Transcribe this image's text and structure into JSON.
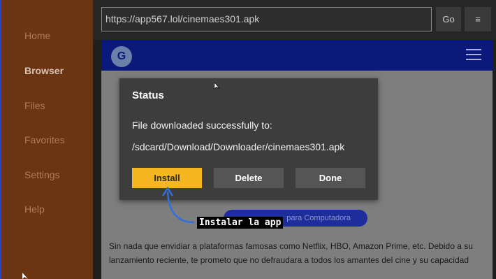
{
  "sidebar": {
    "items": [
      {
        "label": "Home",
        "active": false
      },
      {
        "label": "Browser",
        "active": true
      },
      {
        "label": "Files",
        "active": false
      },
      {
        "label": "Favorites",
        "active": false
      },
      {
        "label": "Settings",
        "active": false
      },
      {
        "label": "Help",
        "active": false
      }
    ]
  },
  "toolbar": {
    "url": "https://app567.lol/cinemaes301.apk",
    "go_label": "Go",
    "menu_icon": "menu-icon"
  },
  "webpage": {
    "pc_button_label": "para Computadora",
    "paragraph_line1": "Sin nada que envidiar a plataformas famosas como Netflix, HBO, Amazon Prime, etc. Debido a su",
    "paragraph_line2": "lanzamiento reciente, te prometo que no defraudara a todos los amantes del cine y su capacidad",
    "header_color": "#0b1a7a"
  },
  "dialog": {
    "title": "Status",
    "message": "File downloaded successfully to:",
    "path": "/sdcard/Download/Downloader/cinemaes301.apk",
    "install_label": "Install",
    "delete_label": "Delete",
    "done_label": "Done",
    "accent": "#f5b622"
  },
  "annotation": {
    "text": "Instalar la app",
    "arrow_color": "#2f6fe0"
  }
}
